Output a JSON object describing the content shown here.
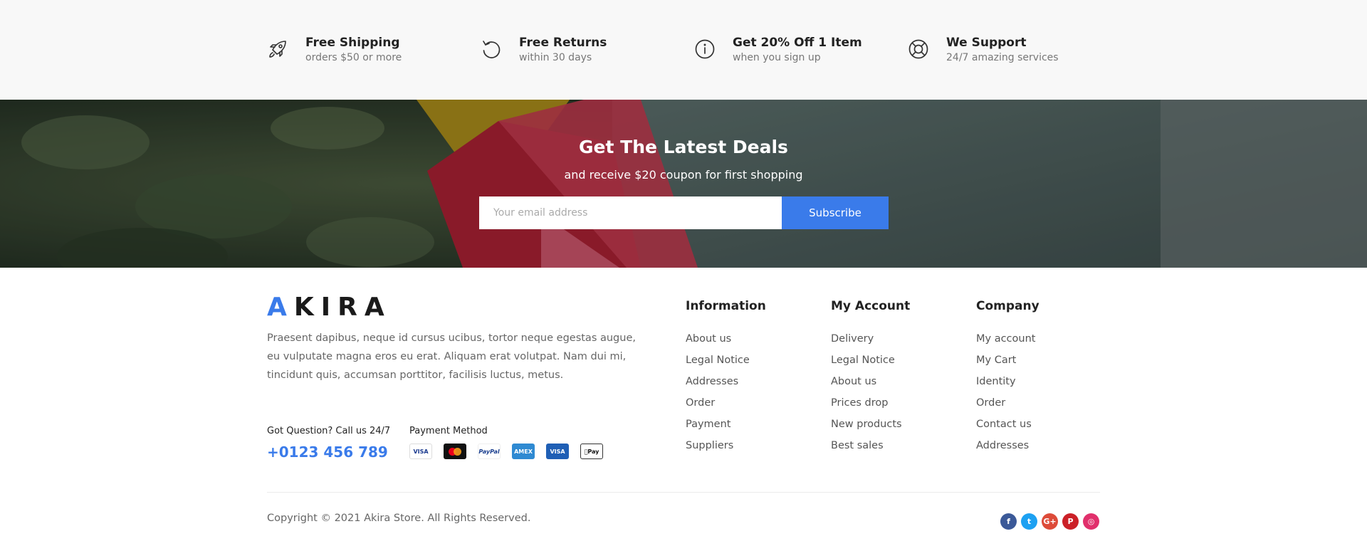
{
  "features": [
    {
      "icon": "rocket-icon",
      "title": "Free Shipping",
      "subtitle": "orders $50 or more"
    },
    {
      "icon": "rotate-ccw-icon",
      "title": "Free Returns",
      "subtitle": "within 30 days"
    },
    {
      "icon": "info-icon",
      "title": "Get 20% Off 1 Item",
      "subtitle": "when you sign up"
    },
    {
      "icon": "life-ring-icon",
      "title": "We Support",
      "subtitle": "24/7 amazing services"
    }
  ],
  "newsletter": {
    "title": "Get The Latest Deals",
    "subtitle": "and receive $20 coupon for first shopping",
    "placeholder": "Your email address",
    "button_label": "Subscribe"
  },
  "footer": {
    "logo_first": "A",
    "logo_rest": "KIRA",
    "about": "Praesent dapibus, neque id cursus ucibus, tortor neque egestas augue, eu vulputate magna eros eu erat. Aliquam erat volutpat. Nam dui mi, tincidunt quis, accumsan porttitor, facilisis luctus, metus.",
    "call_label": "Got Question? Call us 24/7",
    "phone": "+0123 456 789",
    "payment_label": "Payment Method",
    "payment_methods": [
      {
        "icon": "visa-card-icon",
        "text": "VISA"
      },
      {
        "icon": "mastercard-icon",
        "text": ""
      },
      {
        "icon": "paypal-icon",
        "text": "PayPal"
      },
      {
        "icon": "amex-card-icon",
        "text": "AMEX"
      },
      {
        "icon": "visa-card-icon",
        "text": "VISA"
      },
      {
        "icon": "apple-pay-icon",
        "text": "Pay"
      }
    ],
    "columns": [
      {
        "title": "Information",
        "links": [
          "About us",
          "Legal Notice",
          "Addresses",
          "Order",
          "Payment",
          "Suppliers"
        ]
      },
      {
        "title": "My Account",
        "links": [
          "Delivery",
          "Legal Notice",
          "About us",
          "Prices drop",
          "New products",
          "Best sales"
        ]
      },
      {
        "title": "Company",
        "links": [
          "My account",
          "My Cart",
          "Identity",
          "Order",
          "Contact us",
          "Addresses"
        ]
      }
    ],
    "copyright": "Copyright © 2021 Akira Store. All Rights Reserved.",
    "social": [
      {
        "icon": "facebook-icon",
        "glyph": "f",
        "color": "#3b5998"
      },
      {
        "icon": "twitter-icon",
        "glyph": "t",
        "color": "#1da1f2"
      },
      {
        "icon": "google-plus-icon",
        "glyph": "G+",
        "color": "#dd4b39"
      },
      {
        "icon": "pinterest-icon",
        "glyph": "P",
        "color": "#cb2027"
      },
      {
        "icon": "instagram-icon",
        "glyph": "◎",
        "color": "#e1306c"
      }
    ]
  },
  "colors": {
    "accent": "#3a7bea",
    "dark": "#1a1a1a"
  }
}
